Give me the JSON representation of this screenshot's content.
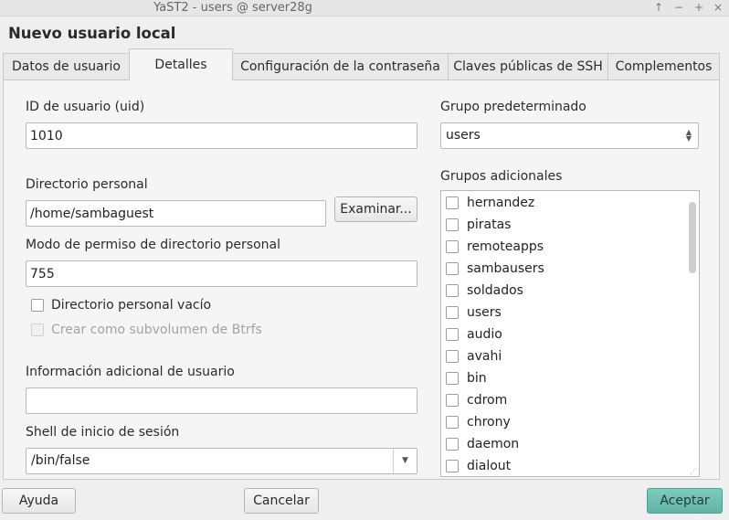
{
  "window": {
    "title": "YaST2 - users @ server28g",
    "controls": [
      "↑",
      "−",
      "+",
      "×"
    ]
  },
  "page_title": "Nuevo usuario local",
  "tabs": [
    {
      "label": "Datos de usuario",
      "active": false
    },
    {
      "label": "Detalles",
      "active": true
    },
    {
      "label": "Configuración de la contraseña",
      "active": false
    },
    {
      "label": "Claves públicas de SSH",
      "active": false
    },
    {
      "label": "Complementos",
      "active": false
    }
  ],
  "form": {
    "uid_label": "ID de usuario (uid)",
    "uid_value": "1010",
    "home_label": "Directorio personal",
    "home_value": "/home/sambaguest",
    "browse_label": "Examinar...",
    "perm_label": "Modo de permiso de directorio personal",
    "perm_value": "755",
    "empty_home_label": "Directorio personal vacío",
    "btrfs_label": "Crear como subvolumen de Btrfs",
    "gecos_label": "Información adicional de usuario",
    "gecos_value": "",
    "shell_label": "Shell de inicio de sesión",
    "shell_value": "/bin/false",
    "default_group_label": "Grupo predeterminado",
    "default_group_value": "users",
    "additional_groups_label": "Grupos adicionales"
  },
  "groups": [
    "hernandez",
    "piratas",
    "remoteapps",
    "sambausers",
    "soldados",
    "users",
    "audio",
    "avahi",
    "bin",
    "cdrom",
    "chrony",
    "daemon",
    "dialout"
  ],
  "footer": {
    "help_label": "Ayuda",
    "cancel_label": "Cancelar",
    "accept_label": "Aceptar"
  },
  "colors": {
    "accent": "#6cbdb0",
    "background": "#efefef"
  }
}
